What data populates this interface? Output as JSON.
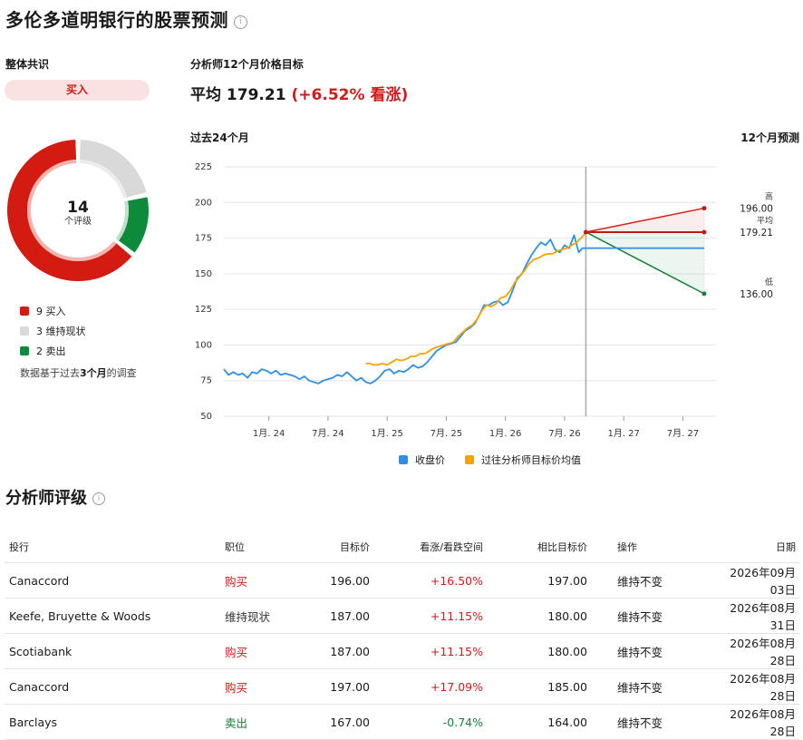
{
  "title": "多伦多道明银行的股票预测",
  "consensus": {
    "label": "整体共识",
    "rating": "买入",
    "total": "14",
    "total_label": "个评级",
    "breakdown": [
      {
        "label": "9 买入",
        "count": 9,
        "color": "#d41b12"
      },
      {
        "label": "3 维持现状",
        "count": 3,
        "color": "#d9d9d9"
      },
      {
        "label": "2 卖出",
        "count": 2,
        "color": "#0d8a3a"
      }
    ],
    "note_prefix": "数据基于过去",
    "note_bold": "3个月",
    "note_suffix": "的调查"
  },
  "target": {
    "heading": "分析师12个月价格目标",
    "avg_label": "平均 179.21",
    "change_label": "(+6.52% 看涨)",
    "past_label": "过去24个月",
    "forecast_label": "12个月预测"
  },
  "chart_data": {
    "type": "line",
    "ylim": [
      50,
      225
    ],
    "yticks": [
      50,
      75,
      100,
      125,
      150,
      175,
      200,
      225
    ],
    "xticks": [
      {
        "label": "1月. 24",
        "t": 2024.0
      },
      {
        "label": "7月. 24",
        "t": 2024.5
      },
      {
        "label": "1月. 25",
        "t": 2025.0
      },
      {
        "label": "7月. 25",
        "t": 2025.5
      },
      {
        "label": "1月. 26",
        "t": 2026.0
      },
      {
        "label": "7月. 26",
        "t": 2026.5
      },
      {
        "label": "1月. 27",
        "t": 2027.0
      },
      {
        "label": "7月. 27",
        "t": 2027.5
      }
    ],
    "xlim": [
      2023.62,
      2027.78
    ],
    "now": 2026.68,
    "forecast_end": 2027.68,
    "series": [
      {
        "name": "收盘价",
        "color": "#2d8fe6",
        "points": [
          [
            2023.62,
            83
          ],
          [
            2023.66,
            79
          ],
          [
            2023.7,
            81
          ],
          [
            2023.74,
            79
          ],
          [
            2023.78,
            80
          ],
          [
            2023.82,
            77
          ],
          [
            2023.86,
            81
          ],
          [
            2023.9,
            80
          ],
          [
            2023.94,
            83
          ],
          [
            2023.98,
            82
          ],
          [
            2024.02,
            80
          ],
          [
            2024.06,
            82
          ],
          [
            2024.1,
            79
          ],
          [
            2024.14,
            80
          ],
          [
            2024.18,
            79
          ],
          [
            2024.22,
            78
          ],
          [
            2024.26,
            76
          ],
          [
            2024.3,
            78
          ],
          [
            2024.34,
            75
          ],
          [
            2024.38,
            74
          ],
          [
            2024.42,
            73
          ],
          [
            2024.46,
            75
          ],
          [
            2024.5,
            76
          ],
          [
            2024.54,
            77
          ],
          [
            2024.58,
            79
          ],
          [
            2024.62,
            78
          ],
          [
            2024.66,
            81
          ],
          [
            2024.7,
            78
          ],
          [
            2024.74,
            75
          ],
          [
            2024.78,
            77
          ],
          [
            2024.82,
            74
          ],
          [
            2024.86,
            73
          ],
          [
            2024.9,
            75
          ],
          [
            2024.94,
            78
          ],
          [
            2024.98,
            82
          ],
          [
            2025.02,
            83
          ],
          [
            2025.06,
            80
          ],
          [
            2025.1,
            82
          ],
          [
            2025.14,
            81
          ],
          [
            2025.18,
            83
          ],
          [
            2025.22,
            86
          ],
          [
            2025.26,
            84
          ],
          [
            2025.3,
            85
          ],
          [
            2025.34,
            88
          ],
          [
            2025.38,
            92
          ],
          [
            2025.42,
            96
          ],
          [
            2025.46,
            98
          ],
          [
            2025.5,
            100
          ],
          [
            2025.54,
            101
          ],
          [
            2025.58,
            102
          ],
          [
            2025.62,
            106
          ],
          [
            2025.66,
            110
          ],
          [
            2025.7,
            112
          ],
          [
            2025.74,
            115
          ],
          [
            2025.78,
            121
          ],
          [
            2025.82,
            128
          ],
          [
            2025.86,
            128
          ],
          [
            2025.9,
            130
          ],
          [
            2025.94,
            131
          ],
          [
            2025.98,
            128
          ],
          [
            2026.02,
            130
          ],
          [
            2026.06,
            138
          ],
          [
            2026.1,
            147
          ],
          [
            2026.14,
            150
          ],
          [
            2026.18,
            157
          ],
          [
            2026.22,
            163
          ],
          [
            2026.26,
            168
          ],
          [
            2026.3,
            172
          ],
          [
            2026.34,
            170
          ],
          [
            2026.38,
            174
          ],
          [
            2026.42,
            167
          ],
          [
            2026.46,
            165
          ],
          [
            2026.5,
            170
          ],
          [
            2026.54,
            168
          ],
          [
            2026.58,
            177
          ],
          [
            2026.62,
            165
          ],
          [
            2026.65,
            168
          ],
          [
            2026.68,
            168
          ]
        ]
      },
      {
        "name": "过往分析师目标价均值",
        "color": "#f5a300",
        "points": [
          [
            2024.82,
            87
          ],
          [
            2024.86,
            87
          ],
          [
            2024.88,
            86
          ],
          [
            2024.92,
            86
          ],
          [
            2024.96,
            87
          ],
          [
            2025.0,
            86
          ],
          [
            2025.04,
            88
          ],
          [
            2025.08,
            90
          ],
          [
            2025.12,
            89
          ],
          [
            2025.16,
            90
          ],
          [
            2025.2,
            92
          ],
          [
            2025.24,
            92
          ],
          [
            2025.28,
            94
          ],
          [
            2025.32,
            94
          ],
          [
            2025.36,
            96
          ],
          [
            2025.4,
            98
          ],
          [
            2025.44,
            99
          ],
          [
            2025.48,
            100
          ],
          [
            2025.52,
            101
          ],
          [
            2025.56,
            102
          ],
          [
            2025.6,
            106
          ],
          [
            2025.64,
            109
          ],
          [
            2025.68,
            112
          ],
          [
            2025.72,
            114
          ],
          [
            2025.76,
            118
          ],
          [
            2025.8,
            124
          ],
          [
            2025.84,
            128
          ],
          [
            2025.88,
            127
          ],
          [
            2025.92,
            129
          ],
          [
            2025.96,
            133
          ],
          [
            2026.0,
            134
          ],
          [
            2026.04,
            138
          ],
          [
            2026.08,
            144
          ],
          [
            2026.12,
            148
          ],
          [
            2026.16,
            152
          ],
          [
            2026.2,
            157
          ],
          [
            2026.24,
            160
          ],
          [
            2026.28,
            161
          ],
          [
            2026.32,
            163
          ],
          [
            2026.36,
            164
          ],
          [
            2026.4,
            164
          ],
          [
            2026.44,
            166
          ],
          [
            2026.48,
            167
          ],
          [
            2026.52,
            168
          ],
          [
            2026.56,
            170
          ],
          [
            2026.6,
            172
          ],
          [
            2026.64,
            175
          ],
          [
            2026.68,
            179
          ]
        ]
      }
    ],
    "forecast": {
      "high": {
        "label": "高",
        "value": 196.0,
        "text": "196.00"
      },
      "avg": {
        "label": "平均",
        "value": 179.21,
        "text": "179.21"
      },
      "low": {
        "label": "低",
        "value": 136.0,
        "text": "136.00"
      },
      "start": 179.21
    },
    "legend": [
      {
        "name": "收盘价",
        "color": "#2d8fe6"
      },
      {
        "name": "过往分析师目标价均值",
        "color": "#f5a300"
      }
    ]
  },
  "ratings": {
    "title": "分析师评级",
    "headers": [
      "投行",
      "职位",
      "目标价",
      "看涨/看跌空间",
      "相比目标价",
      "操作",
      "日期"
    ],
    "rows": [
      {
        "bank": "Canaccord",
        "position": "购买",
        "ptype": "buy",
        "target": "196.00",
        "upside": "+16.50%",
        "dir": "up",
        "prev": "197.00",
        "action": "维持不变",
        "date": "2026年09月03日"
      },
      {
        "bank": "Keefe, Bruyette & Woods",
        "position": "维持现状",
        "ptype": "hold",
        "target": "187.00",
        "upside": "+11.15%",
        "dir": "up",
        "prev": "180.00",
        "action": "维持不变",
        "date": "2026年08月31日"
      },
      {
        "bank": "Scotiabank",
        "position": "购买",
        "ptype": "buy",
        "target": "187.00",
        "upside": "+11.15%",
        "dir": "up",
        "prev": "180.00",
        "action": "维持不变",
        "date": "2026年08月28日"
      },
      {
        "bank": "Canaccord",
        "position": "购买",
        "ptype": "buy",
        "target": "197.00",
        "upside": "+17.09%",
        "dir": "up",
        "prev": "185.00",
        "action": "维持不变",
        "date": "2026年08月28日"
      },
      {
        "bank": "Barclays",
        "position": "卖出",
        "ptype": "sell",
        "target": "167.00",
        "upside": "-0.74%",
        "dir": "down",
        "prev": "164.00",
        "action": "维持不变",
        "date": "2026年08月28日"
      }
    ]
  }
}
